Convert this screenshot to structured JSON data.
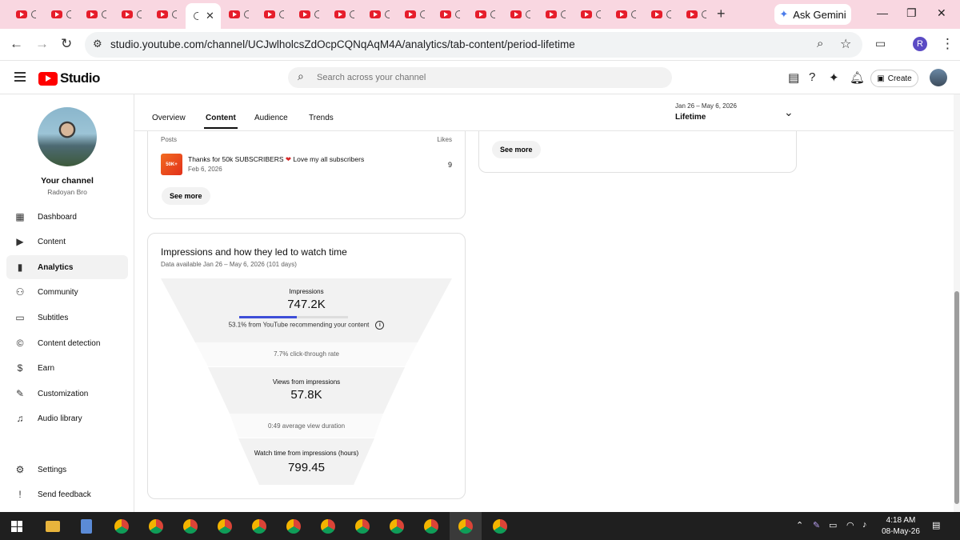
{
  "browser": {
    "tab_close": "✕",
    "new_tab": "+",
    "ask_gemini": "Ask Gemini",
    "url": "studio.youtube.com/channel/UCJwlholcsZdOcpCQNqAqM4A/analytics/tab-content/period-lifetime",
    "profile_initial": "R"
  },
  "header": {
    "logo_text": "Studio",
    "search_placeholder": "Search across your channel",
    "create_label": "Create"
  },
  "sidebar": {
    "channel_title": "Your channel",
    "channel_name": "Radoyan Bro",
    "items": [
      {
        "label": "Dashboard"
      },
      {
        "label": "Content"
      },
      {
        "label": "Analytics"
      },
      {
        "label": "Community"
      },
      {
        "label": "Subtitles"
      },
      {
        "label": "Content detection"
      },
      {
        "label": "Earn"
      },
      {
        "label": "Customization"
      },
      {
        "label": "Audio library"
      },
      {
        "label": "Settings"
      },
      {
        "label": "Send feedback"
      }
    ]
  },
  "tabs": [
    "Overview",
    "Content",
    "Audience",
    "Trends"
  ],
  "period": {
    "range": "Jan 26 – May 6, 2026",
    "label": "Lifetime"
  },
  "posts": {
    "col_posts": "Posts",
    "col_likes": "Likes",
    "item": {
      "thumb": "50K+",
      "title_before": "Thanks for 50k SUBSCRIBERS",
      "title_after": "Love my all subscribers",
      "date": "Feb 6, 2026",
      "likes": "9"
    },
    "see_more": "See more"
  },
  "right_card": {
    "see_more": "See more"
  },
  "funnel": {
    "title": "Impressions and how they led to watch time",
    "subtitle": "Data available Jan 26 – May 6, 2026 (101 days)",
    "impressions_label": "Impressions",
    "impressions_value": "747.2K",
    "recommend_text": "53.1% from YouTube recommending your content",
    "recommend_fraction": 0.531,
    "ctr_text": "7.7% click-through rate",
    "views_label": "Views from impressions",
    "views_value": "57.8K",
    "avd_text": "0:49 average view duration",
    "watch_label": "Watch time from impressions (hours)",
    "watch_value": "799.45"
  },
  "taskbar": {
    "time": "4:18 AM",
    "date": "08-May-26"
  }
}
